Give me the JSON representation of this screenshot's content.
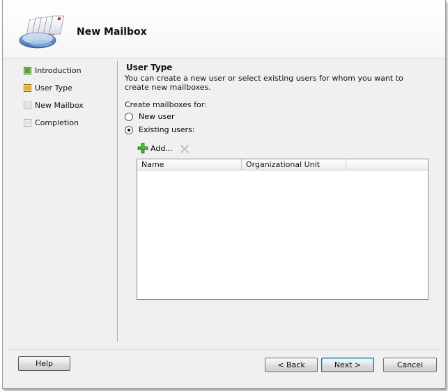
{
  "header": {
    "title": "New Mailbox",
    "icon": "mailbox-wizard-icon"
  },
  "nav": {
    "items": [
      {
        "label": "Introduction",
        "state": "done"
      },
      {
        "label": "User Type",
        "state": "current"
      },
      {
        "label": "New Mailbox",
        "state": "pending"
      },
      {
        "label": "Completion",
        "state": "pending"
      }
    ]
  },
  "content": {
    "section_title": "User Type",
    "description": "You can create a new user or select existing users for whom you want to create new mailboxes.",
    "create_label": "Create mailboxes for:",
    "options": [
      {
        "label": "New user",
        "checked": false
      },
      {
        "label": "Existing users:",
        "checked": true
      }
    ],
    "toolbar": {
      "add_label": "Add...",
      "add_icon": "plus-icon",
      "remove_icon": "remove-x-icon"
    },
    "list": {
      "columns": [
        "Name",
        "Organizational Unit",
        ""
      ],
      "rows": []
    }
  },
  "buttons": {
    "help": "Help",
    "back": "< Back",
    "next": "Next >",
    "cancel": "Cancel"
  },
  "colors": {
    "step_done": "#5aa02c",
    "step_current": "#e8b020",
    "step_pending": "#e4e4e4",
    "add_icon_green": "#3fae2a"
  }
}
